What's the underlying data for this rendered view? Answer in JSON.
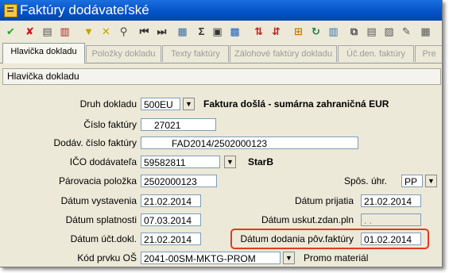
{
  "window": {
    "title": "Faktúry dodávateľské"
  },
  "toolbar": {
    "icons": [
      {
        "name": "confirm-icon",
        "glyph": "✔",
        "color": "#2aa22a"
      },
      {
        "name": "cancel-icon",
        "glyph": "✘",
        "color": "#d0121b"
      },
      {
        "name": "document-list-icon",
        "glyph": "▤",
        "color": "#555555"
      },
      {
        "name": "delete-icon",
        "glyph": "▥",
        "color": "#b02020"
      },
      {
        "name": "filter-icon",
        "glyph": "▼",
        "color": "#c8a000"
      },
      {
        "name": "filter-clear-icon",
        "glyph": "✕",
        "color": "#c8a000"
      },
      {
        "name": "find-icon",
        "glyph": "⚲",
        "color": "#444444"
      },
      {
        "name": "first-record-icon",
        "glyph": "⏮",
        "color": "#333333"
      },
      {
        "name": "last-record-icon",
        "glyph": "⏭",
        "color": "#333333"
      },
      {
        "name": "calculator-icon",
        "glyph": "▦",
        "color": "#3a6ea5"
      },
      {
        "name": "sum-icon",
        "glyph": "Σ",
        "color": "#333333"
      },
      {
        "name": "print-icon",
        "glyph": "▣",
        "color": "#333333"
      },
      {
        "name": "export-icon",
        "glyph": "▩",
        "color": "#2060c0"
      },
      {
        "name": "sort-ascending-icon",
        "glyph": "⇅",
        "color": "#c02020"
      },
      {
        "name": "sort-descending-icon",
        "glyph": "⇵",
        "color": "#c02020"
      },
      {
        "name": "tree-icon",
        "glyph": "⊞",
        "color": "#c08000"
      },
      {
        "name": "refresh-icon",
        "glyph": "↻",
        "color": "#208040"
      },
      {
        "name": "columns-icon",
        "glyph": "▥",
        "color": "#3a6ea5"
      },
      {
        "name": "copy-icon",
        "glyph": "⧉",
        "color": "#555555"
      },
      {
        "name": "paste-icon",
        "glyph": "▤",
        "color": "#555555"
      },
      {
        "name": "settings-icon",
        "glyph": "▨",
        "color": "#555555"
      },
      {
        "name": "edit-icon",
        "glyph": "✎",
        "color": "#555555"
      },
      {
        "name": "report-icon",
        "glyph": "▦",
        "color": "#555555"
      }
    ]
  },
  "tabs": [
    {
      "label": "Hlavička dokladu",
      "active": true
    },
    {
      "label": "Položky dokladu",
      "active": false
    },
    {
      "label": "Texty faktúry",
      "active": false
    },
    {
      "label": "Zálohové faktúry dokladu",
      "active": false
    },
    {
      "label": "Úč.den. faktúry",
      "active": false
    },
    {
      "label": "Pre",
      "active": false
    }
  ],
  "panel": {
    "title": "Hlavička dokladu"
  },
  "form": {
    "druh_dokladu": {
      "label": "Druh dokladu",
      "value": "500EU",
      "description": "Faktura došlá - sumárna zahraničná EUR"
    },
    "cislo_faktury": {
      "label": "Číslo faktúry",
      "value": "27021"
    },
    "dodav_cislo": {
      "label": "Dodáv. číslo faktúry",
      "value": "FAD2014/2502000123"
    },
    "ico": {
      "label": "IČO dodávateľa",
      "value": "59582811",
      "description": "StarB"
    },
    "parovacia": {
      "label": "Párovacia položka",
      "value": "2502000123"
    },
    "sposob_uhrady": {
      "label": "Spôs. úhr.",
      "value": "PP"
    },
    "datum_vystavenia": {
      "label": "Dátum vystavenia",
      "value": "21.02.2014"
    },
    "datum_prijatia": {
      "label": "Dátum prijatia",
      "value": "21.02.2014"
    },
    "datum_splatnosti": {
      "label": "Dátum splatnosti",
      "value": "07.03.2014"
    },
    "datum_uskut": {
      "label": "Dátum uskut.zdan.pln",
      "value": "  .  ."
    },
    "datum_uct": {
      "label": "Dátum účt.dokl.",
      "value": "21.02.2014"
    },
    "datum_dodania": {
      "label": "Dátum dodania pôv.faktúry",
      "value": "01.02.2014"
    },
    "kod_prvku": {
      "label": "Kód prvku OŠ",
      "value": "2041-00SM-MKTG-PROM",
      "description": "Promo materiál"
    }
  },
  "highlight_color": "#e03b1f"
}
